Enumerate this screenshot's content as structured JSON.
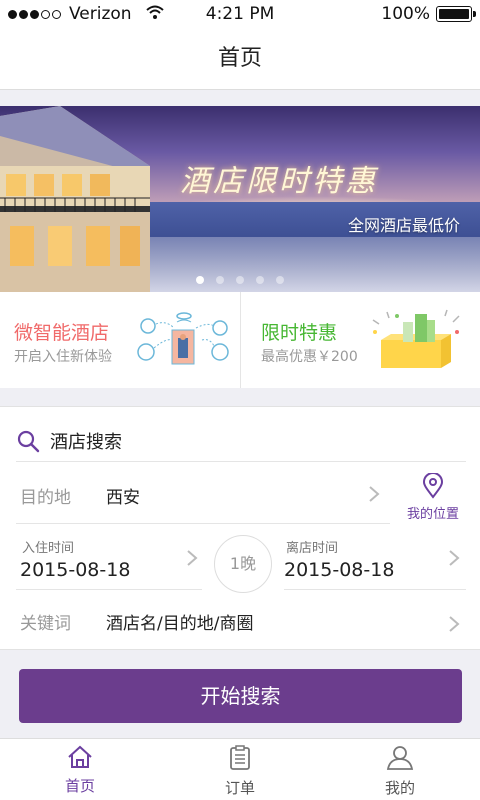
{
  "status_bar": {
    "carrier": "Verizon",
    "time": "4:21 PM",
    "battery": "100%",
    "battery_level": 1.0
  },
  "nav": {
    "title": "首页"
  },
  "banner": {
    "headline": "酒店限时特惠",
    "subline": "全网酒店最低价",
    "slides": 5,
    "active_slide": 1
  },
  "promos": [
    {
      "title": "微智能酒店",
      "subtitle": "开启入住新体验",
      "color": "#f06a6a"
    },
    {
      "title": "限时特惠",
      "subtitle": "最高优惠￥200",
      "color": "#47b733"
    }
  ],
  "search": {
    "title": "酒店搜索",
    "destination_label": "目的地",
    "destination_value": "西安",
    "my_location": "我的位置",
    "checkin_label": "入住时间",
    "checkin_value": "2015-08-18",
    "nights": "1晚",
    "checkout_label": "离店时间",
    "checkout_value": "2015-08-18",
    "keyword_label": "关键词",
    "keyword_placeholder": "酒店名/目的地/商圈",
    "submit": "开始搜索"
  },
  "tabs": [
    {
      "label": "首页",
      "icon": "home-icon",
      "active": true
    },
    {
      "label": "订单",
      "icon": "orders-icon",
      "active": false
    },
    {
      "label": "我的",
      "icon": "profile-icon",
      "active": false
    }
  ],
  "colors": {
    "accent": "#6b3d8d",
    "promo_red": "#f06a6a",
    "promo_green": "#47b733"
  }
}
